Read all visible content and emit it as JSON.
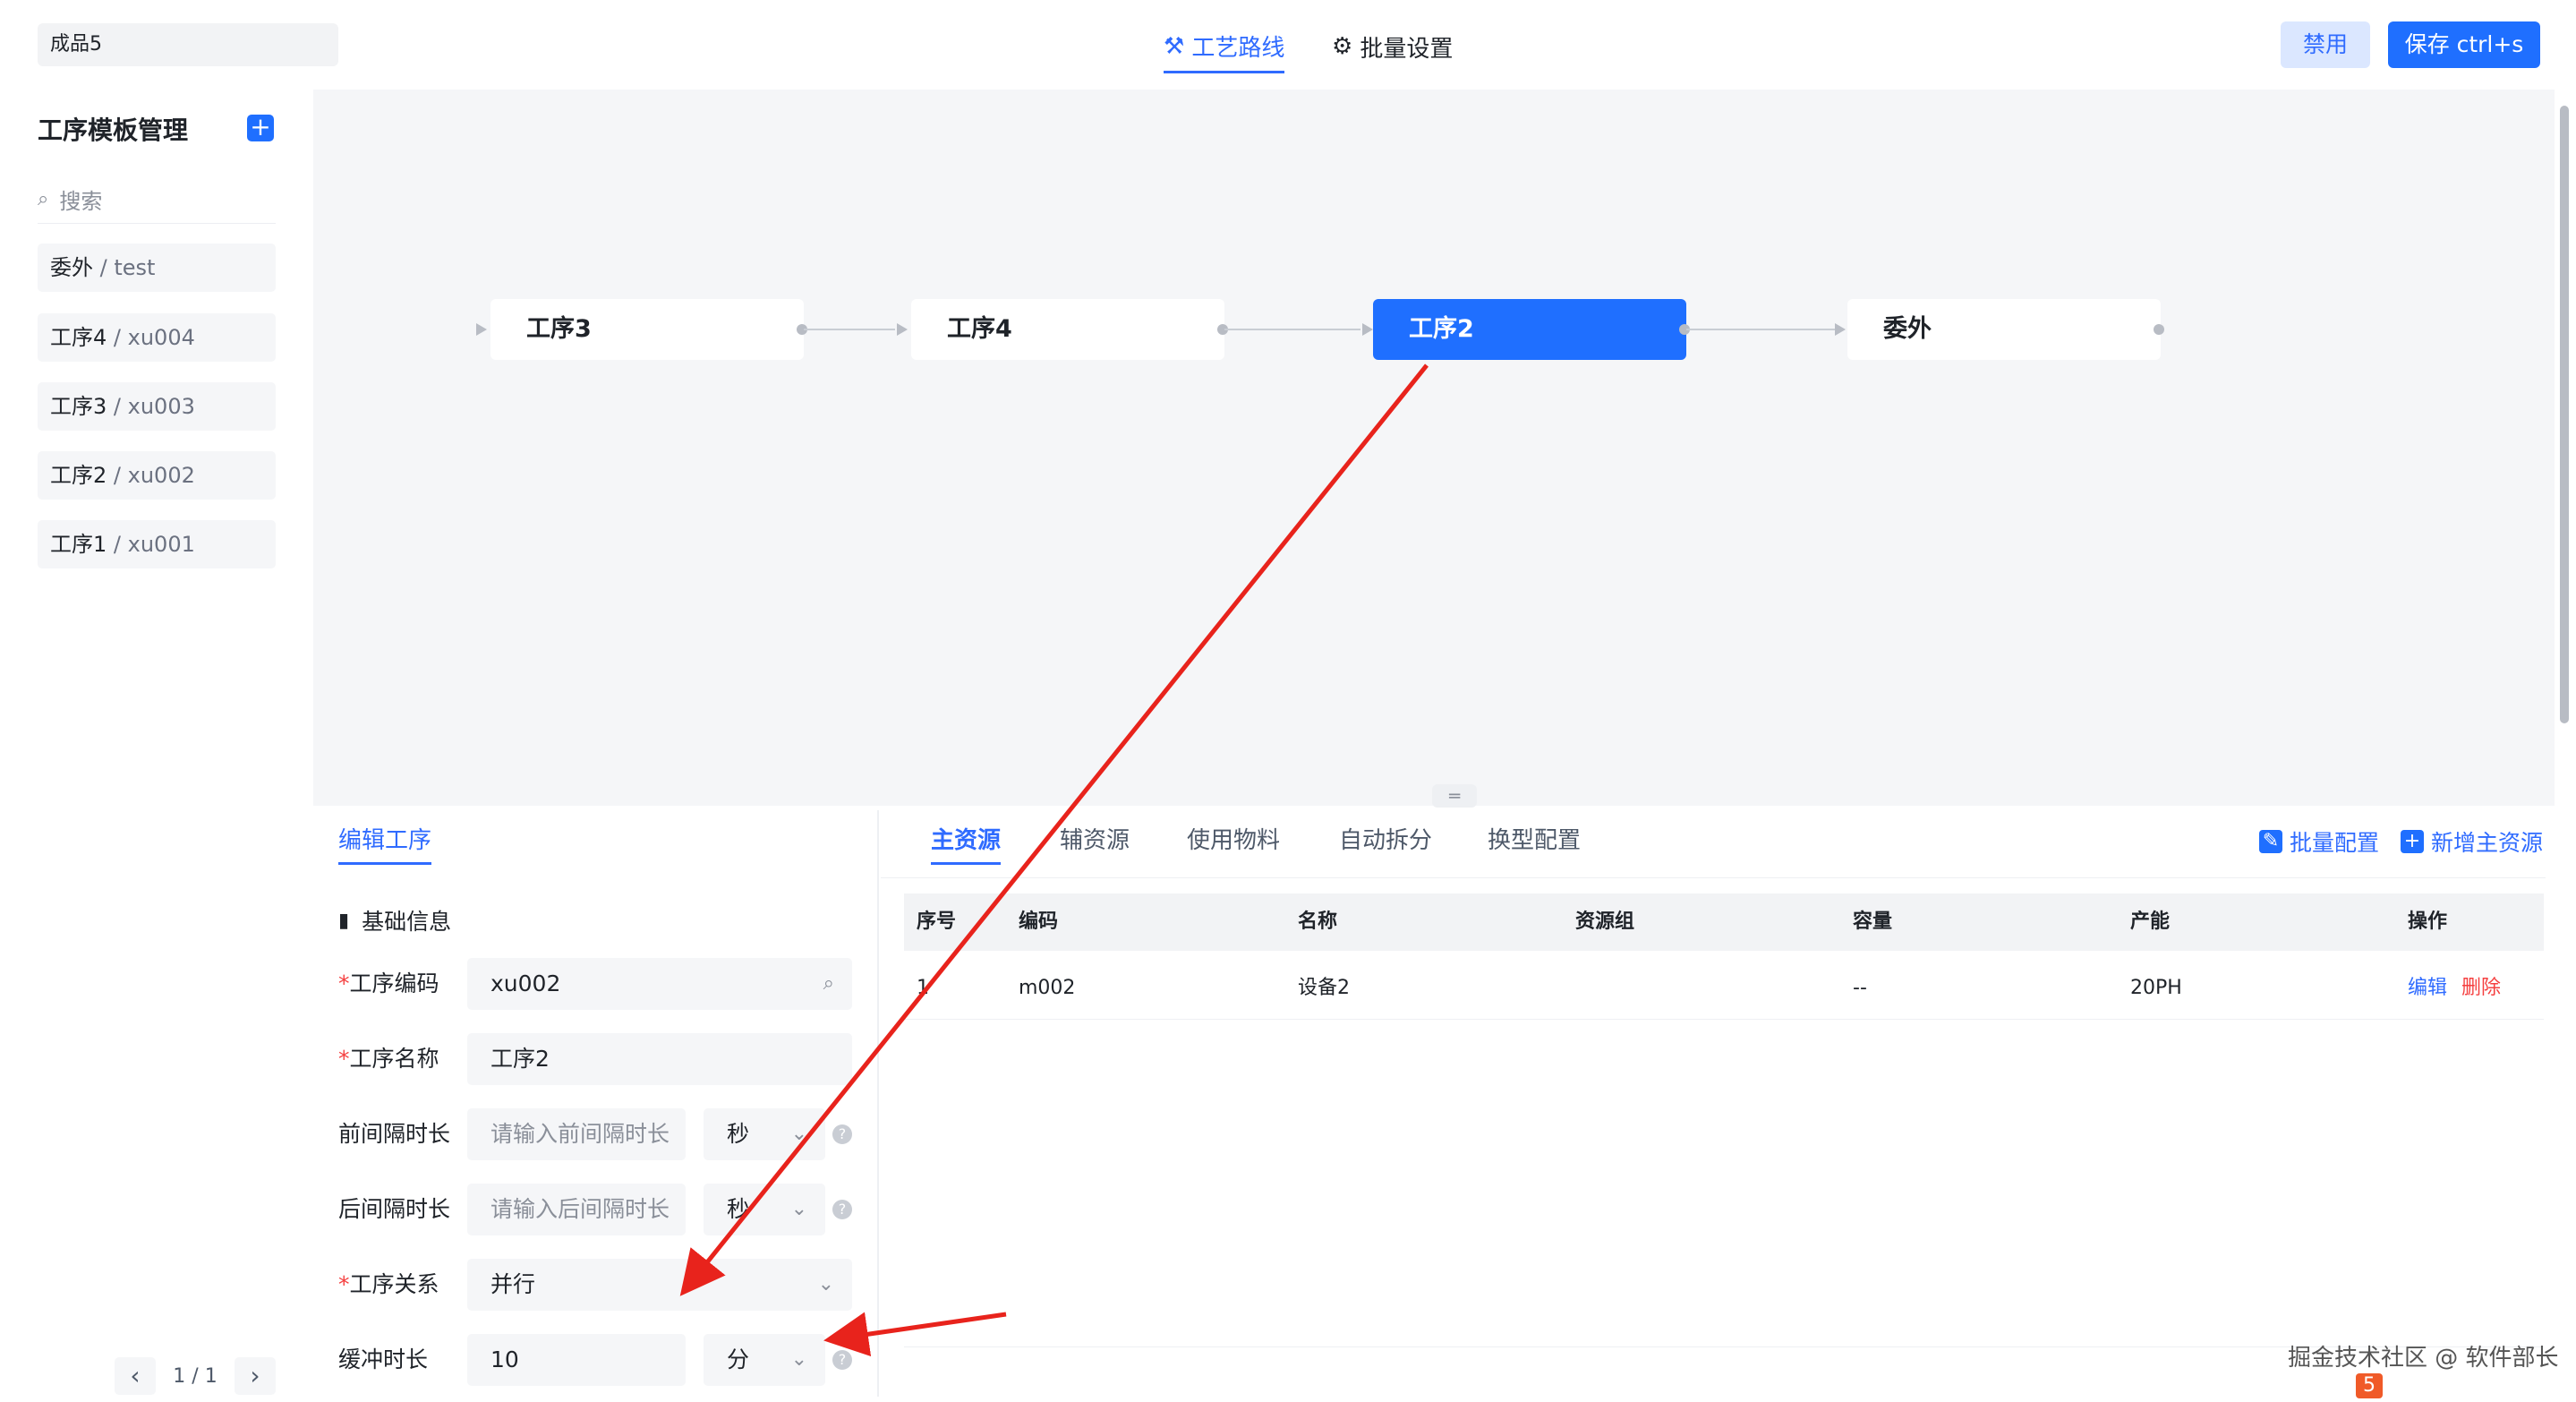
{
  "header": {
    "product_name": "成品5",
    "tabs": [
      {
        "label": "工艺路线",
        "icon": "route-icon"
      },
      {
        "label": "批量设置",
        "icon": "gear-icon"
      }
    ],
    "disable_label": "禁用",
    "save_label": "保存 ctrl+s"
  },
  "sidebar": {
    "title": "工序模板管理",
    "search_placeholder": "搜索",
    "items": [
      {
        "name": "委外",
        "code": "/ test"
      },
      {
        "name": "工序4",
        "code": "/ xu004"
      },
      {
        "name": "工序3",
        "code": "/ xu003"
      },
      {
        "name": "工序2",
        "code": "/ xu002"
      },
      {
        "name": "工序1",
        "code": "/ xu001"
      }
    ],
    "pager": "1 / 1"
  },
  "flow": {
    "nodes": [
      "工序3",
      "工序4",
      "工序2",
      "委外"
    ],
    "active_index": 2,
    "colors": {
      "active": "#1f6fff",
      "node": "#ffffff",
      "canvas": "#f5f6f8"
    }
  },
  "edit": {
    "tab_label": "编辑工序",
    "section_title": "基础信息",
    "fields": {
      "code": {
        "label": "工序编码",
        "value": "xu002"
      },
      "name": {
        "label": "工序名称",
        "value": "工序2"
      },
      "pre_interval": {
        "label": "前间隔时长",
        "placeholder": "请输入前间隔时长",
        "unit": "秒"
      },
      "post_interval": {
        "label": "后间隔时长",
        "placeholder": "请输入后间隔时长",
        "unit": "秒"
      },
      "relation": {
        "label": "工序关系",
        "value": "并行"
      },
      "buffer": {
        "label": "缓冲时长",
        "value": "10",
        "unit": "分"
      }
    }
  },
  "resources": {
    "tabs": [
      "主资源",
      "辅资源",
      "使用物料",
      "自动拆分",
      "换型配置"
    ],
    "batch_config_label": "批量配置",
    "add_main_label": "新增主资源",
    "columns": [
      "序号",
      "编码",
      "名称",
      "资源组",
      "容量",
      "产能",
      "操作"
    ],
    "rows": [
      {
        "index": "1",
        "code": "m002",
        "name": "设备2",
        "group": "",
        "capacity": "--",
        "throughput": "20PH",
        "edit": "编辑",
        "delete": "删除"
      }
    ]
  },
  "footer": {
    "watermark": "掘金技术社区 @ 软件部长"
  },
  "annotation_color": "#e8231c"
}
